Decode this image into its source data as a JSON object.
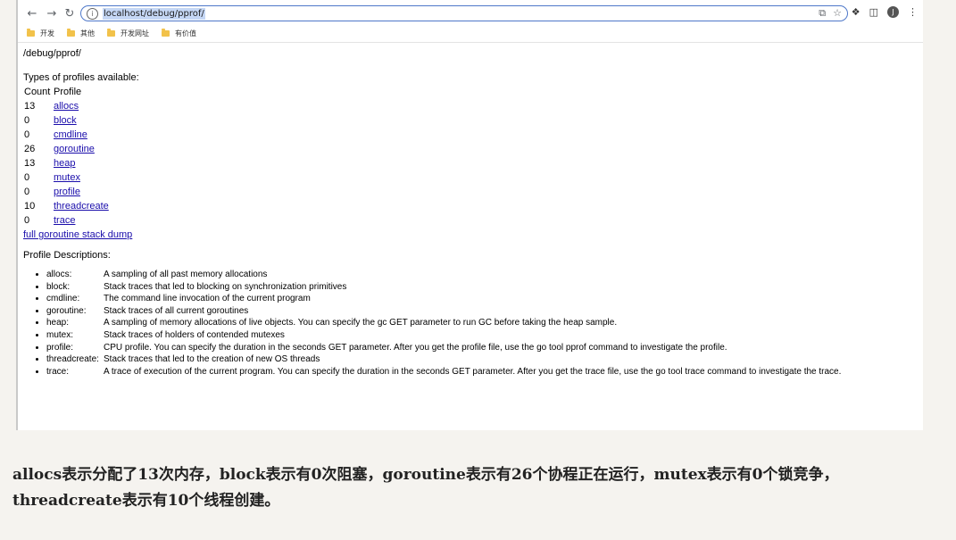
{
  "browser": {
    "url": "localhost/debug/pprof/",
    "bookmarks": [
      "开发",
      "其他",
      "开发网址",
      "有价值"
    ],
    "avatar_letter": "J"
  },
  "page": {
    "path": "/debug/pprof/",
    "types_heading": "Types of profiles available:",
    "col_count": "Count",
    "col_profile": "Profile",
    "profiles": [
      {
        "count": "13",
        "name": "allocs"
      },
      {
        "count": "0",
        "name": "block"
      },
      {
        "count": "0",
        "name": "cmdline"
      },
      {
        "count": "26",
        "name": "goroutine"
      },
      {
        "count": "13",
        "name": "heap"
      },
      {
        "count": "0",
        "name": "mutex"
      },
      {
        "count": "0",
        "name": "profile"
      },
      {
        "count": "10",
        "name": "threadcreate"
      },
      {
        "count": "0",
        "name": "trace"
      }
    ],
    "dump_link": "full goroutine stack dump",
    "desc_heading": "Profile Descriptions:",
    "descriptions": [
      {
        "name": "allocs:",
        "text": "A sampling of all past memory allocations"
      },
      {
        "name": "block:",
        "text": "Stack traces that led to blocking on synchronization primitives"
      },
      {
        "name": "cmdline:",
        "text": "The command line invocation of the current program"
      },
      {
        "name": "goroutine:",
        "text": "Stack traces of all current goroutines"
      },
      {
        "name": "heap:",
        "text": "A sampling of memory allocations of live objects. You can specify the gc GET parameter to run GC before taking the heap sample."
      },
      {
        "name": "mutex:",
        "text": "Stack traces of holders of contended mutexes"
      },
      {
        "name": "profile:",
        "text": "CPU profile. You can specify the duration in the seconds GET parameter. After you get the profile file, use the go tool pprof command to investigate the profile."
      },
      {
        "name": "threadcreate:",
        "text": "Stack traces that led to the creation of new OS threads"
      },
      {
        "name": "trace:",
        "text": "A trace of execution of the current program. You can specify the duration in the seconds GET parameter. After you get the trace file, use the go tool trace command to investigate the trace."
      }
    ]
  },
  "caption": {
    "line1": "allocs表示分配了13次内存，block表示有0次阻塞，goroutine表示有26个协程正在运行，mutex表示有0个锁竞争，",
    "line2": "threadcreate表示有10个线程创建。"
  },
  "icons": {
    "back": "arrow-left-icon",
    "forward": "arrow-right-icon",
    "reload": "reload-icon",
    "info": "info-icon",
    "share": "share-icon",
    "star": "star-icon",
    "extensions": "puzzle-icon",
    "sidepanel": "side-panel-icon",
    "menu": "kebab-menu-icon",
    "folder": "folder-icon"
  }
}
